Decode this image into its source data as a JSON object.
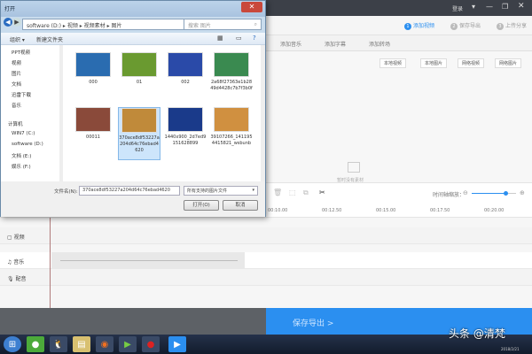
{
  "app": {
    "login": "登录",
    "steps": [
      {
        "num": "1",
        "label": "添加视频"
      },
      {
        "num": "2",
        "label": "保存导出"
      },
      {
        "num": "3",
        "label": "上传分享"
      }
    ],
    "toolbar": [
      "添加音乐",
      "添加字幕",
      "添加转场"
    ],
    "media_buttons": [
      "本地视频",
      "本地图片",
      "网络视频",
      "网络图片"
    ],
    "placeholder": "暂时没有素材",
    "zoom_label": "时间轴缩放：",
    "zoom_level": 0.75,
    "ruler": [
      "00:10.00",
      "00:12.50",
      "00:15.00",
      "00:17.50",
      "00:20.00"
    ],
    "tracks": [
      {
        "icon": "video-icon",
        "label": "视频"
      },
      {
        "icon": "music-icon",
        "label": "音乐"
      },
      {
        "icon": "mic-icon",
        "label": "配音"
      }
    ],
    "export": "保存导出 >",
    "accent": "#2b8ff0"
  },
  "dialog": {
    "title": "打开",
    "path": [
      "software (D:)",
      "视频",
      "视频素材",
      "图片"
    ],
    "search_placeholder": "搜索 图片",
    "organize": "组织 ▾",
    "new_folder": "新建文件夹",
    "nav": [
      "PPT视频",
      "视频",
      "图片",
      "文档",
      "迅雷下载",
      "音乐",
      "计算机",
      "WIN7 (C:)",
      "software (D:)",
      "文档 (E:)",
      "娱乐 (F:)"
    ],
    "files": [
      {
        "name": "000",
        "color": "#2a6cb0"
      },
      {
        "name": "01",
        "color": "#6a9a30"
      },
      {
        "name": "002",
        "color": "#2a4aa8"
      },
      {
        "name": "2a68f27363e1b2849d4428c7b7f3b0f",
        "color": "#3a8a50"
      },
      {
        "name": "00011",
        "color": "#8a4a3a"
      },
      {
        "name": "370ace8df53227a204d64c76ebad4620",
        "color": "#c08a3a",
        "selected": true
      },
      {
        "name": "1440x900_2d7ed9151628899",
        "color": "#1a3a8a"
      },
      {
        "name": "39107266_1411954415821_wsbunb",
        "color": "#d09040"
      }
    ],
    "filename_label": "文件名(N):",
    "filename": "370ace8df53227a204d64c76ebad4620",
    "filetype": "所有支持的图片文件",
    "open": "打开(O)",
    "cancel": "取消"
  },
  "taskbar": {
    "date": "2018/2/21"
  },
  "watermark": "头条 @清梵"
}
